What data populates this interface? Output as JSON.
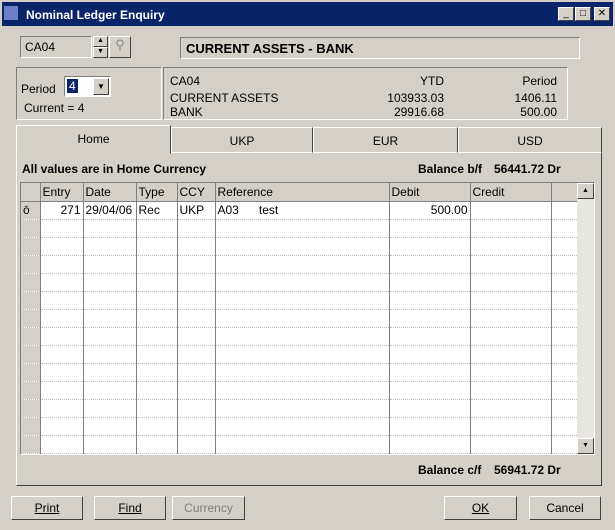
{
  "window": {
    "title": "Nominal Ledger Enquiry",
    "minimize": "_",
    "maximize": "□",
    "close": "✕"
  },
  "account": {
    "code": "CA04",
    "name": "CURRENT ASSETS - BANK"
  },
  "period": {
    "label": "Period",
    "value": "4",
    "current": "Current = 4"
  },
  "summary": {
    "code": "CA04",
    "line1": "CURRENT ASSETS",
    "line2": "BANK",
    "ytd_label": "YTD",
    "period_label": "Period",
    "ytd1": "103933.03",
    "ytd2": "29916.68",
    "per1": "1406.11",
    "per2": "500.00"
  },
  "tabs": [
    {
      "label": "Home"
    },
    {
      "label": "UKP"
    },
    {
      "label": "EUR"
    },
    {
      "label": "USD"
    }
  ],
  "info": {
    "note": "All values are in Home Currency",
    "bf_label": "Balance b/f",
    "bf_value": "56441.72 Dr",
    "cf_label": "Balance c/f",
    "cf_value": "56941.72 Dr"
  },
  "grid": {
    "columns": [
      "Entry",
      "Date",
      "Type",
      "CCY",
      "Reference",
      "Debit",
      "Credit"
    ],
    "rows": [
      {
        "entry": "271",
        "date": "29/04/06",
        "type": "Rec",
        "ccy": "UKP",
        "ref": "A03",
        "ref2": "test",
        "debit": "500.00",
        "credit": ""
      }
    ]
  },
  "buttons": {
    "print": "Print",
    "find": "Find",
    "currency": "Currency",
    "ok": "OK",
    "cancel": "Cancel"
  }
}
